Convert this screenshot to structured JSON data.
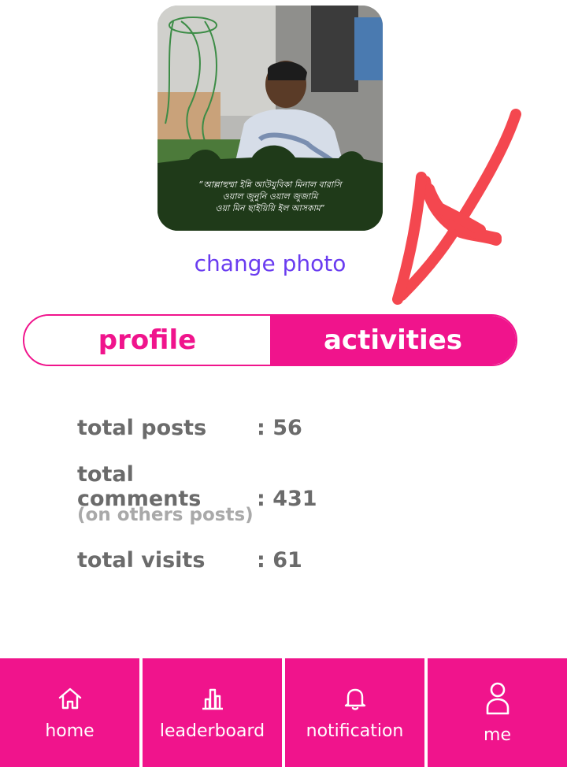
{
  "profile_photo": {
    "banner_lines": [
      "“আল্লাহুম্মা ইন্নি আউযুবিকা মিনাল বারাসি",
      "ওয়াল জুনুনি ওয়াল জুজামি",
      "ওয়া মিন ছাইয়িয়ি ইল আসকাম”"
    ]
  },
  "change_photo_label": "change photo",
  "tabs": {
    "profile": "profile",
    "activities": "activities",
    "active": "activities"
  },
  "stats": {
    "posts": {
      "label": "total posts",
      "value": ": 56"
    },
    "comments": {
      "label": "total comments",
      "value": ": 431",
      "note": "(on others posts)"
    },
    "visits": {
      "label": "total visits",
      "value": ": 61"
    }
  },
  "nav": {
    "home": "home",
    "leaderboard": "leaderboard",
    "notification": "notification",
    "me": "me"
  },
  "colors": {
    "accent": "#f0148c",
    "link": "#6a3cf0",
    "text": "#6b6b6b",
    "muted": "#a9a9a9",
    "annotation": "#f4474f"
  }
}
